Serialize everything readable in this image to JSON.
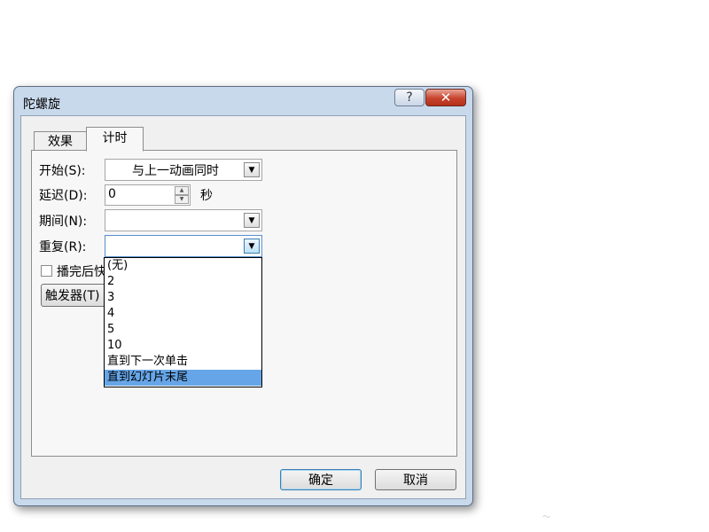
{
  "dialog": {
    "title": "陀螺旋",
    "help_label": "?",
    "close_label": "✕",
    "tabs": [
      {
        "label": "效果",
        "active": false
      },
      {
        "label": "计时",
        "active": true
      }
    ]
  },
  "timing": {
    "start_label": "开始(S):",
    "start_value": "与上一动画同时",
    "delay_label": "延迟(D):",
    "delay_value": "0",
    "delay_unit": "秒",
    "duration_label": "期间(N):",
    "duration_value": "",
    "repeat_label": "重复(R):",
    "repeat_value": "",
    "rewind_label": "播完后快",
    "triggers_label": "触发器(T)"
  },
  "repeat_dropdown": {
    "options": [
      "(无)",
      "2",
      "3",
      "4",
      "5",
      "10",
      "直到下一次单击",
      "直到幻灯片末尾"
    ],
    "selected_index": 7
  },
  "footer": {
    "ok_label": "确定",
    "cancel_label": "取消"
  },
  "decoration": "～"
}
